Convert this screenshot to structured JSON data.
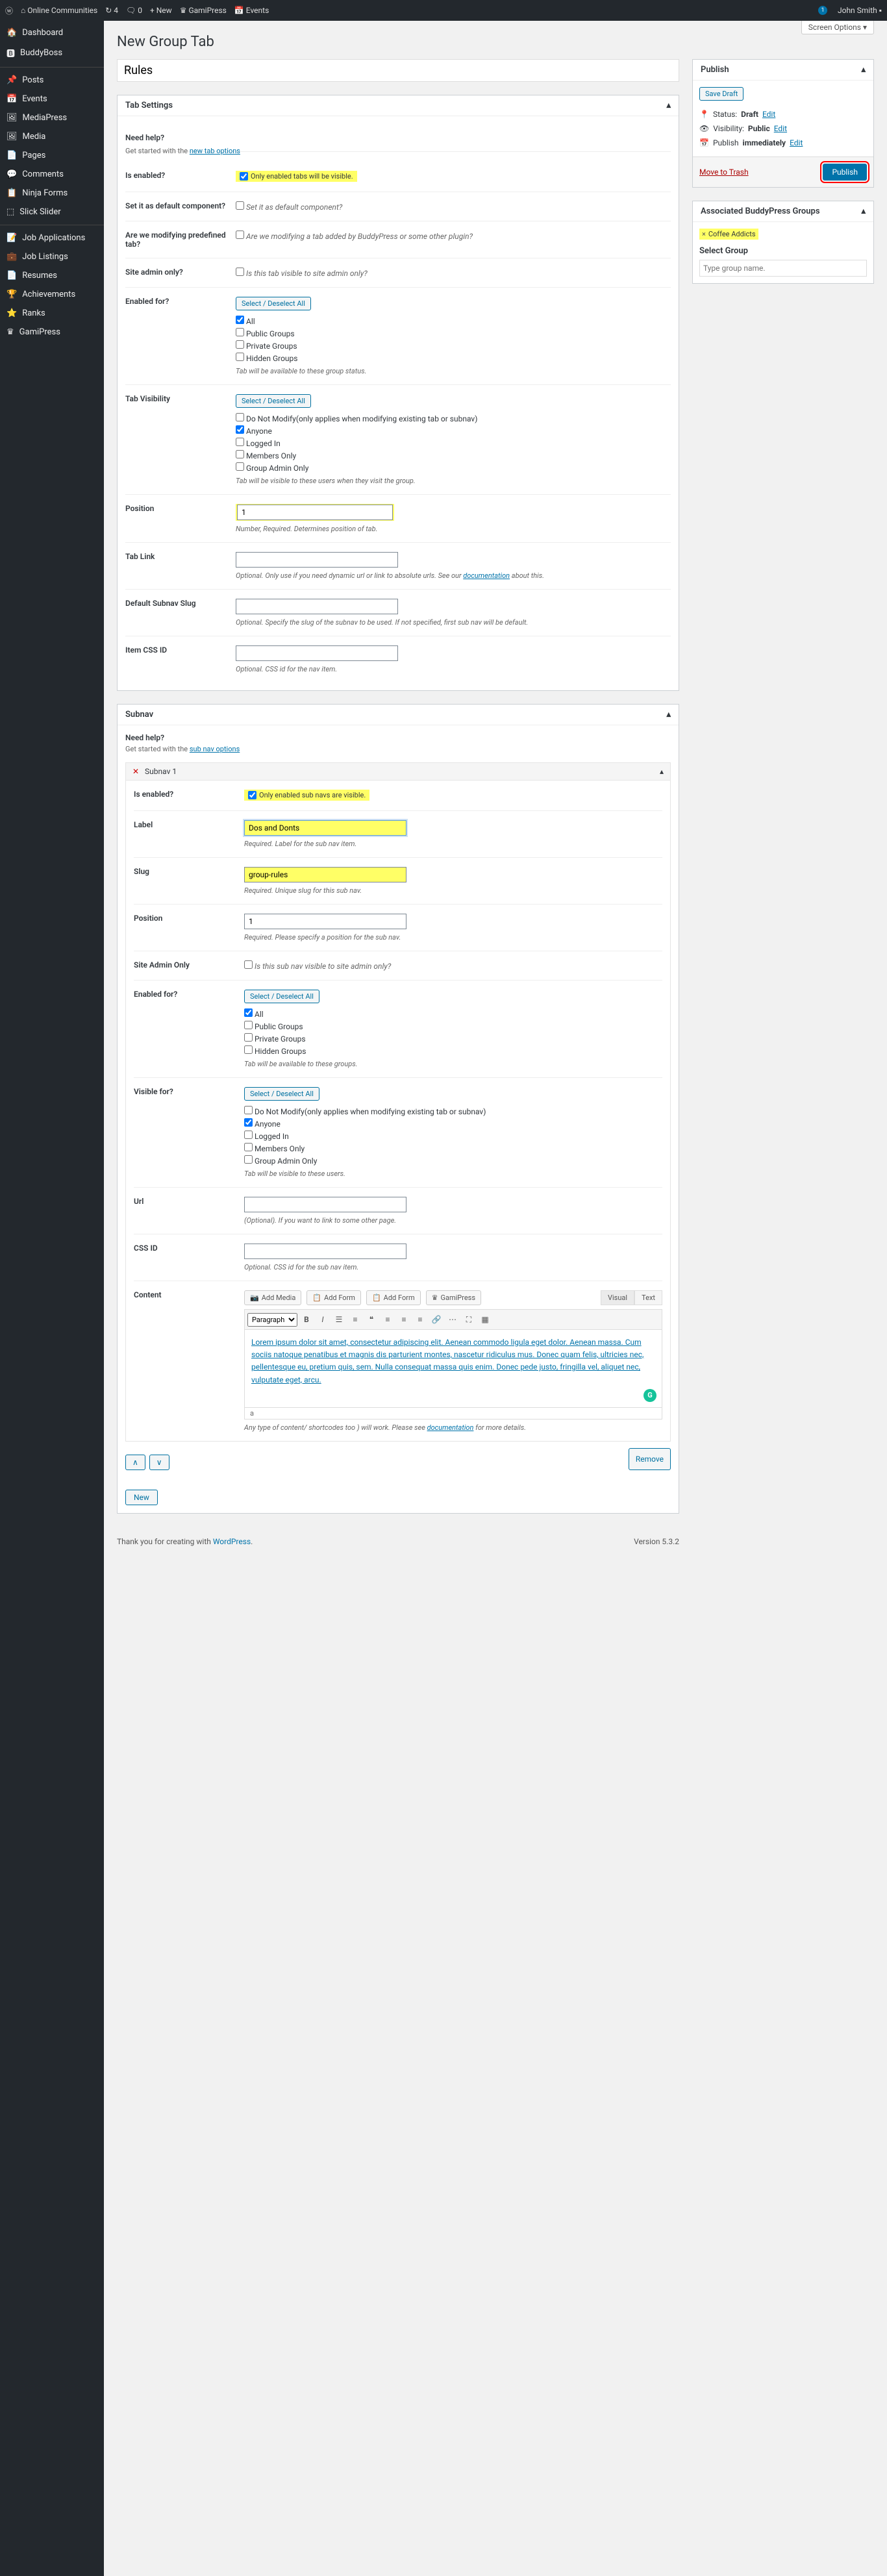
{
  "adminbar": {
    "site": "Online Communities",
    "updates": "4",
    "comments": "0",
    "new": "New",
    "gami": "GamiPress",
    "events": "Events",
    "user": "John Smith"
  },
  "sidebar": {
    "items": [
      {
        "label": "Dashboard"
      },
      {
        "label": "BuddyBoss"
      },
      {
        "label": "Posts"
      },
      {
        "label": "Events"
      },
      {
        "label": "MediaPress"
      },
      {
        "label": "Media"
      },
      {
        "label": "Pages"
      },
      {
        "label": "Comments"
      },
      {
        "label": "Ninja Forms"
      },
      {
        "label": "Slick Slider"
      },
      {
        "label": "Job Applications"
      },
      {
        "label": "Job Listings"
      },
      {
        "label": "Resumes"
      },
      {
        "label": "Achievements"
      },
      {
        "label": "Ranks"
      },
      {
        "label": "GamiPress"
      }
    ]
  },
  "screenOptions": "Screen Options ▾",
  "page": {
    "heading": "New Group Tab",
    "title": "Rules"
  },
  "tabSettings": {
    "header": "Tab Settings",
    "help": {
      "label": "Need help?",
      "text": "Get started with the ",
      "link": "new tab options"
    },
    "enabled": {
      "label": "Is enabled?",
      "check": "Only enabled tabs will be visible."
    },
    "default": {
      "label": "Set it as default component?",
      "check": "Set it as default component?"
    },
    "modifying": {
      "label": "Are we modifying predefined tab?",
      "check": "Are we modifying a tab added by BuddyPress or some other plugin?"
    },
    "adminOnly": {
      "label": "Site admin only?",
      "check": "Is this tab visible to site admin only?"
    },
    "enabledFor": {
      "label": "Enabled for?",
      "btn": "Select / Deselect All",
      "opts": [
        "All",
        "Public Groups",
        "Private Groups",
        "Hidden Groups"
      ],
      "desc": "Tab will be available to these group status."
    },
    "visibility": {
      "label": "Tab Visibility",
      "btn": "Select / Deselect All",
      "opts": [
        "Do Not Modify(only applies when modifying existing tab or subnav)",
        "Anyone",
        "Logged In",
        "Members Only",
        "Group Admin Only"
      ],
      "desc": "Tab will be visible to these users when they visit the group."
    },
    "position": {
      "label": "Position",
      "value": "1",
      "desc": "Number, Required. Determines position of tab."
    },
    "tabLink": {
      "label": "Tab Link",
      "desc1": "Optional. Only use if you need dynamic url or link to absolute urls. See our ",
      "link": "documentation",
      "desc2": " about this."
    },
    "defaultSlug": {
      "label": "Default Subnav Slug",
      "desc": "Optional. Specify the slug of the subnav to be used. If not specified, first sub nav will be default."
    },
    "cssId": {
      "label": "Item CSS ID",
      "desc": "Optional. CSS id for the nav item."
    }
  },
  "subnav": {
    "header": "Subnav",
    "help": {
      "label": "Need help?",
      "text": "Get started with the ",
      "link": "sub nav options"
    },
    "item": {
      "title": "Subnav 1",
      "enabled": {
        "label": "Is enabled?",
        "check": "Only enabled sub navs are visible."
      },
      "labelField": {
        "label": "Label",
        "value": "Dos and Donts",
        "desc": "Required. Label for the sub nav item."
      },
      "slug": {
        "label": "Slug",
        "value": "group-rules",
        "desc": "Required. Unique slug for this sub nav."
      },
      "position": {
        "label": "Position",
        "value": "1",
        "desc": "Required. Please specify a position for the sub nav."
      },
      "adminOnly": {
        "label": "Site Admin Only",
        "check": "Is this sub nav visible to site admin only?"
      },
      "enabledFor": {
        "label": "Enabled for?",
        "btn": "Select / Deselect All",
        "opts": [
          "All",
          "Public Groups",
          "Private Groups",
          "Hidden Groups"
        ],
        "desc": "Tab will be available to these groups."
      },
      "visibleFor": {
        "label": "Visible for?",
        "btn": "Select / Deselect All",
        "opts": [
          "Do Not Modify(only applies when modifying existing tab or subnav)",
          "Anyone",
          "Logged In",
          "Members Only",
          "Group Admin Only"
        ],
        "desc": "Tab will be visible to these users."
      },
      "url": {
        "label": "Url",
        "desc": "(Optional). If you want to link to some other page."
      },
      "cssId": {
        "label": "CSS ID",
        "desc": "Optional. CSS id for the sub nav item."
      },
      "content": {
        "label": "Content",
        "addMedia": "Add Media",
        "addFormNinja": "Add Form",
        "addForm": "Add Form",
        "gami": "GamiPress",
        "visual": "Visual",
        "text": "Text",
        "paragraph": "Paragraph",
        "body": "Lorem ipsum dolor sit amet, consectetur adipiscing elit. Aenean commodo ligula eget dolor. Aenean massa. Cum sociis natoque penatibus et magnis dis parturient montes, nascetur ridiculus mus. Donec quam felis, ultricies nec, pellentesque eu, pretium quis, sem. Nulla consequat massa quis enim. Donec pede justo, fringilla vel, aliquet nec, vulputate eget, arcu.",
        "path": "a",
        "desc1": "Any type of content/ shortcodes too ) will work. Please see ",
        "link": "documentation",
        "desc2": " for more details."
      },
      "remove": "Remove"
    },
    "new": "New"
  },
  "publish": {
    "header": "Publish",
    "saveDraft": "Save Draft",
    "statusLabel": "Status:",
    "status": "Draft",
    "edit": "Edit",
    "visLabel": "Visibility:",
    "vis": "Public",
    "pubLabel": "Publish",
    "pubVal": "immediately",
    "trash": "Move to Trash",
    "btn": "Publish"
  },
  "groups": {
    "header": "Associated BuddyPress Groups",
    "chip": "Coffee Addicts",
    "x": "×",
    "select": "Select Group",
    "placeholder": "Type group name."
  },
  "footer": {
    "thanks": "Thank you for creating with ",
    "wp": "WordPress",
    "version": "Version 5.3.2"
  }
}
